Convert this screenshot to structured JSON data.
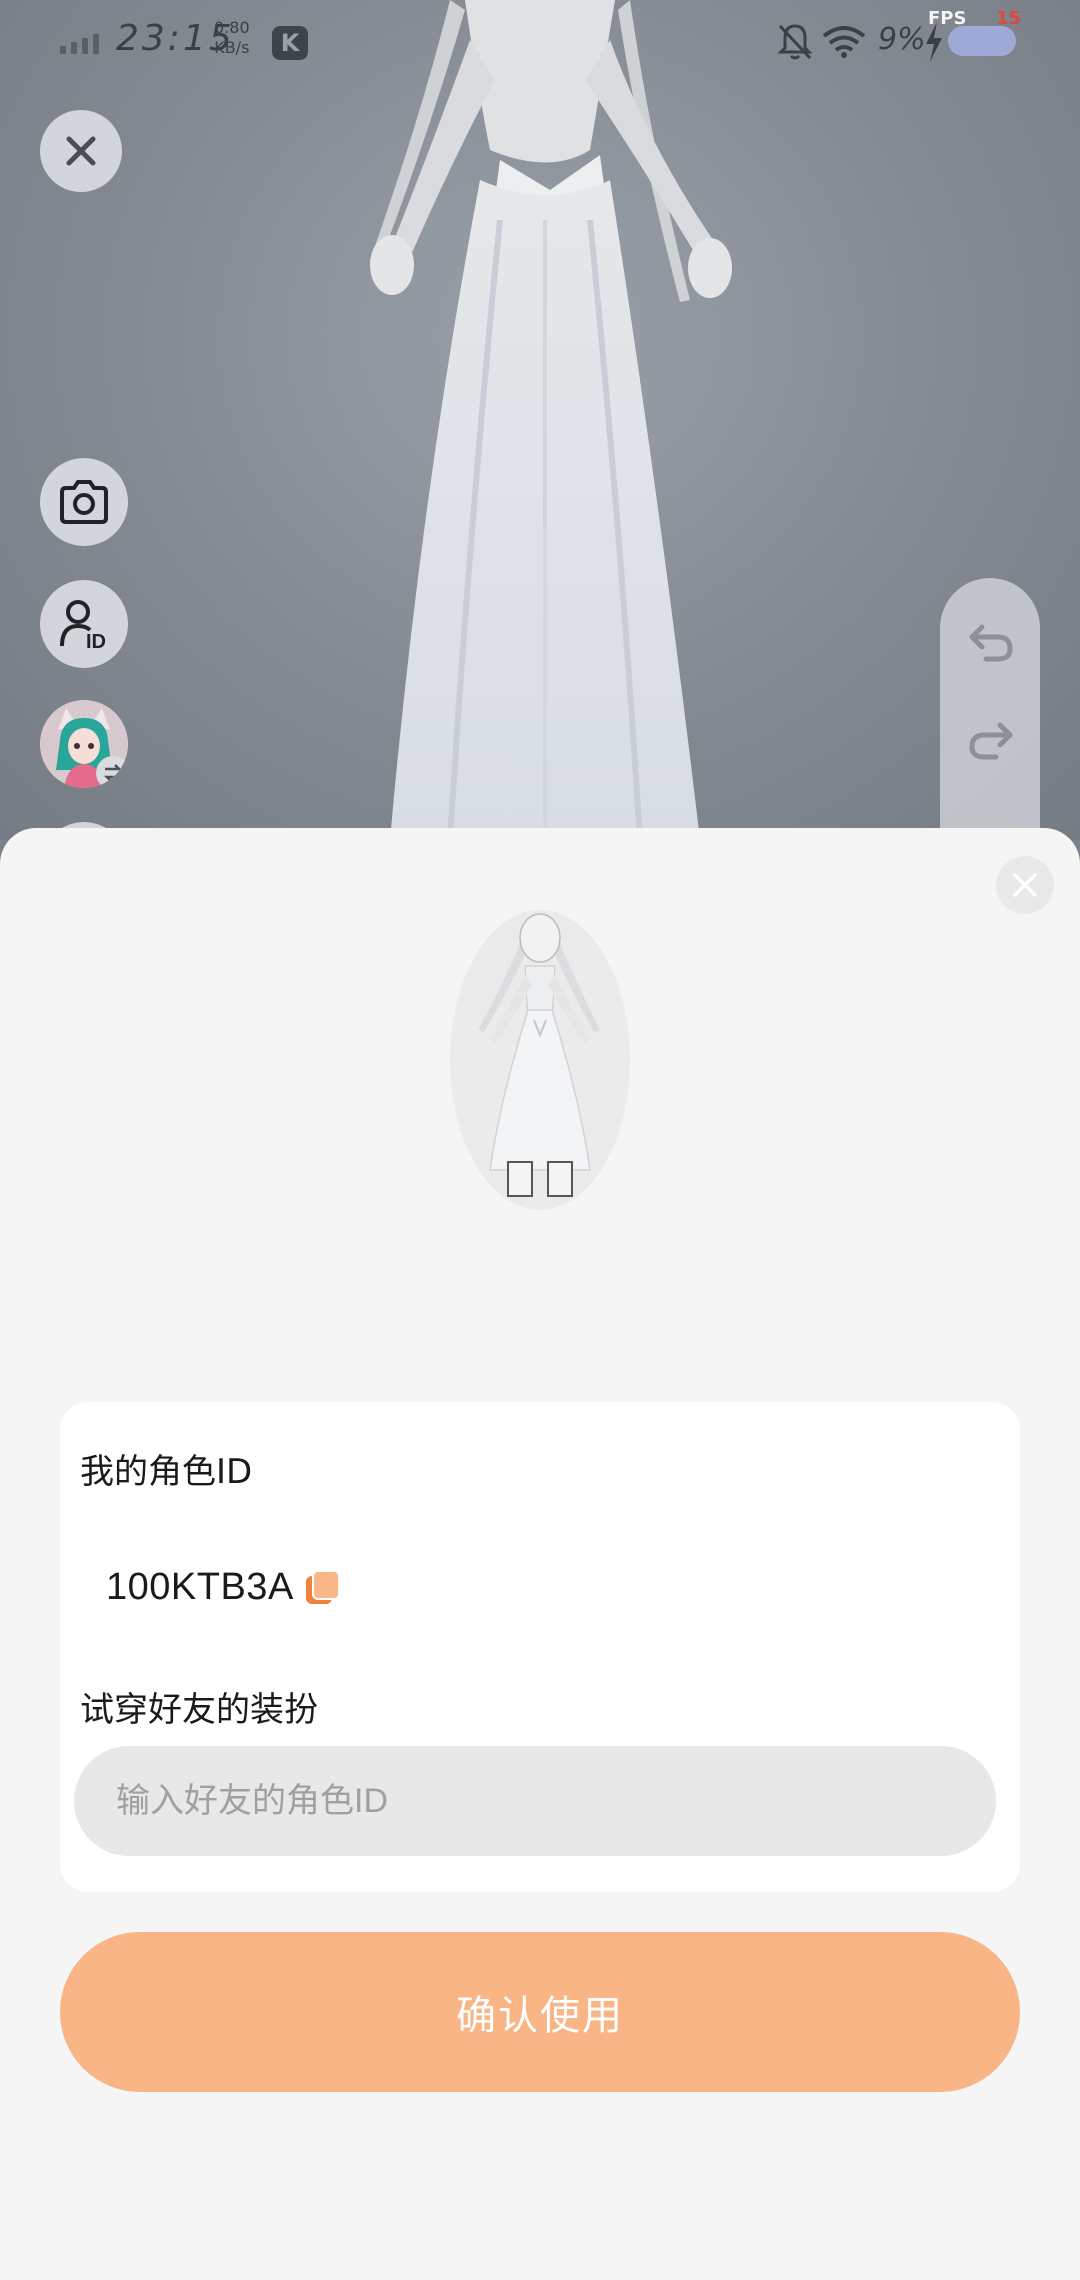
{
  "status_bar": {
    "time": "23:15",
    "speed_value": "0.80",
    "speed_unit": "KB/s",
    "app_badge": "K",
    "battery": "9%",
    "fps_label": "FPS",
    "fps_value": "15"
  },
  "icons": {
    "close": "close-icon",
    "camera": "camera-icon",
    "role_id": "user-id-icon",
    "swap": "swap-icon",
    "undo": "undo-icon",
    "redo": "redo-icon"
  },
  "sheet": {
    "my_role_id_label": "我的角色ID",
    "my_role_id_value": "100KTB3A",
    "try_on_label": "试穿好友的装扮",
    "friend_id_input": {
      "value": "",
      "placeholder": "输入好友的角色ID"
    },
    "confirm_label": "确认使用"
  },
  "colors": {
    "accent": "#f9b585",
    "copy_icon": "#f0823c",
    "fps_value": "#e0473e"
  }
}
